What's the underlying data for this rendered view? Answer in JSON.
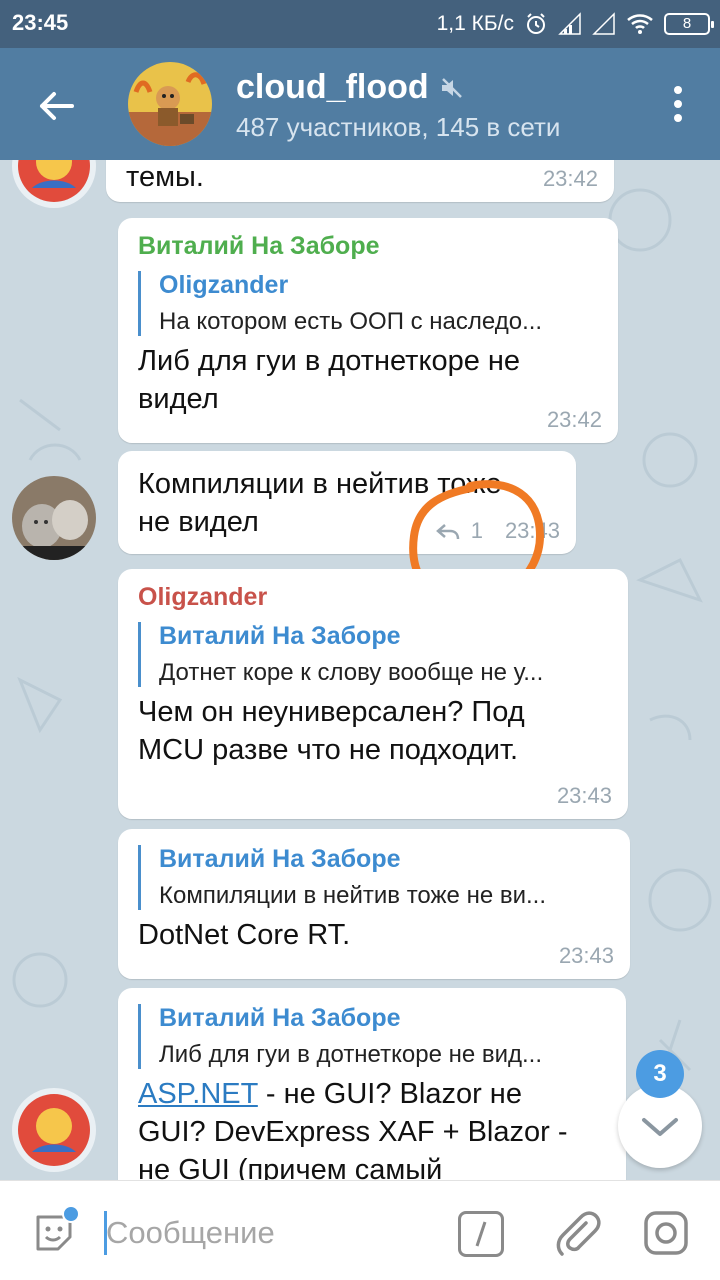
{
  "status_bar": {
    "time": "23:45",
    "speed": "1,1 КБ/с",
    "battery": "8"
  },
  "header": {
    "title": "cloud_flood",
    "subtitle": "487 участников, 145 в сети",
    "back_icon": "arrow-left-icon",
    "mute_icon": "muted-speaker-icon",
    "menu_icon": "more-vertical-icon"
  },
  "messages": [
    {
      "text": "темы.",
      "time": "23:42"
    },
    {
      "sender": "Виталий На Заборе",
      "sender_color": "#4fae4e",
      "reply_name": "Oligzander",
      "reply_text": "На котором есть ООП с наследо...",
      "text_line1": "Либ для гуи в дотнеткоре не",
      "text_line2": "видел",
      "time": "23:42"
    },
    {
      "text_line1": "Компиляции в нейтив тоже",
      "text_line2": "не видел",
      "replies": "1",
      "time": "23:43"
    },
    {
      "sender": "Oligzander",
      "sender_color": "#c8524a",
      "reply_name": "Виталий На Заборе",
      "reply_text": "Дотнет коре к слову вообще не у...",
      "text_line1": "Чем он неуниверсален? Под",
      "text_line2": "MCU разве что не подходит.",
      "time": "23:43"
    },
    {
      "reply_name": "Виталий На Заборе",
      "reply_text": "Компиляции в нейтив тоже не ви...",
      "text": "DotNet Core RT.",
      "time": "23:43"
    },
    {
      "reply_name": "Виталий На Заборе",
      "reply_text": "Либ для гуи в дотнеткоре не вид...",
      "link": "ASP.NET",
      "text_after_link": " - не GUI? Blazor не",
      "text_line2": "GUI? DevExpress XAF + Blazor -",
      "text_line3": "не GUI (причем самый"
    }
  ],
  "scroll": {
    "unread_count": "3",
    "icon": "chevron-down-icon"
  },
  "input": {
    "placeholder": "Сообщение"
  }
}
